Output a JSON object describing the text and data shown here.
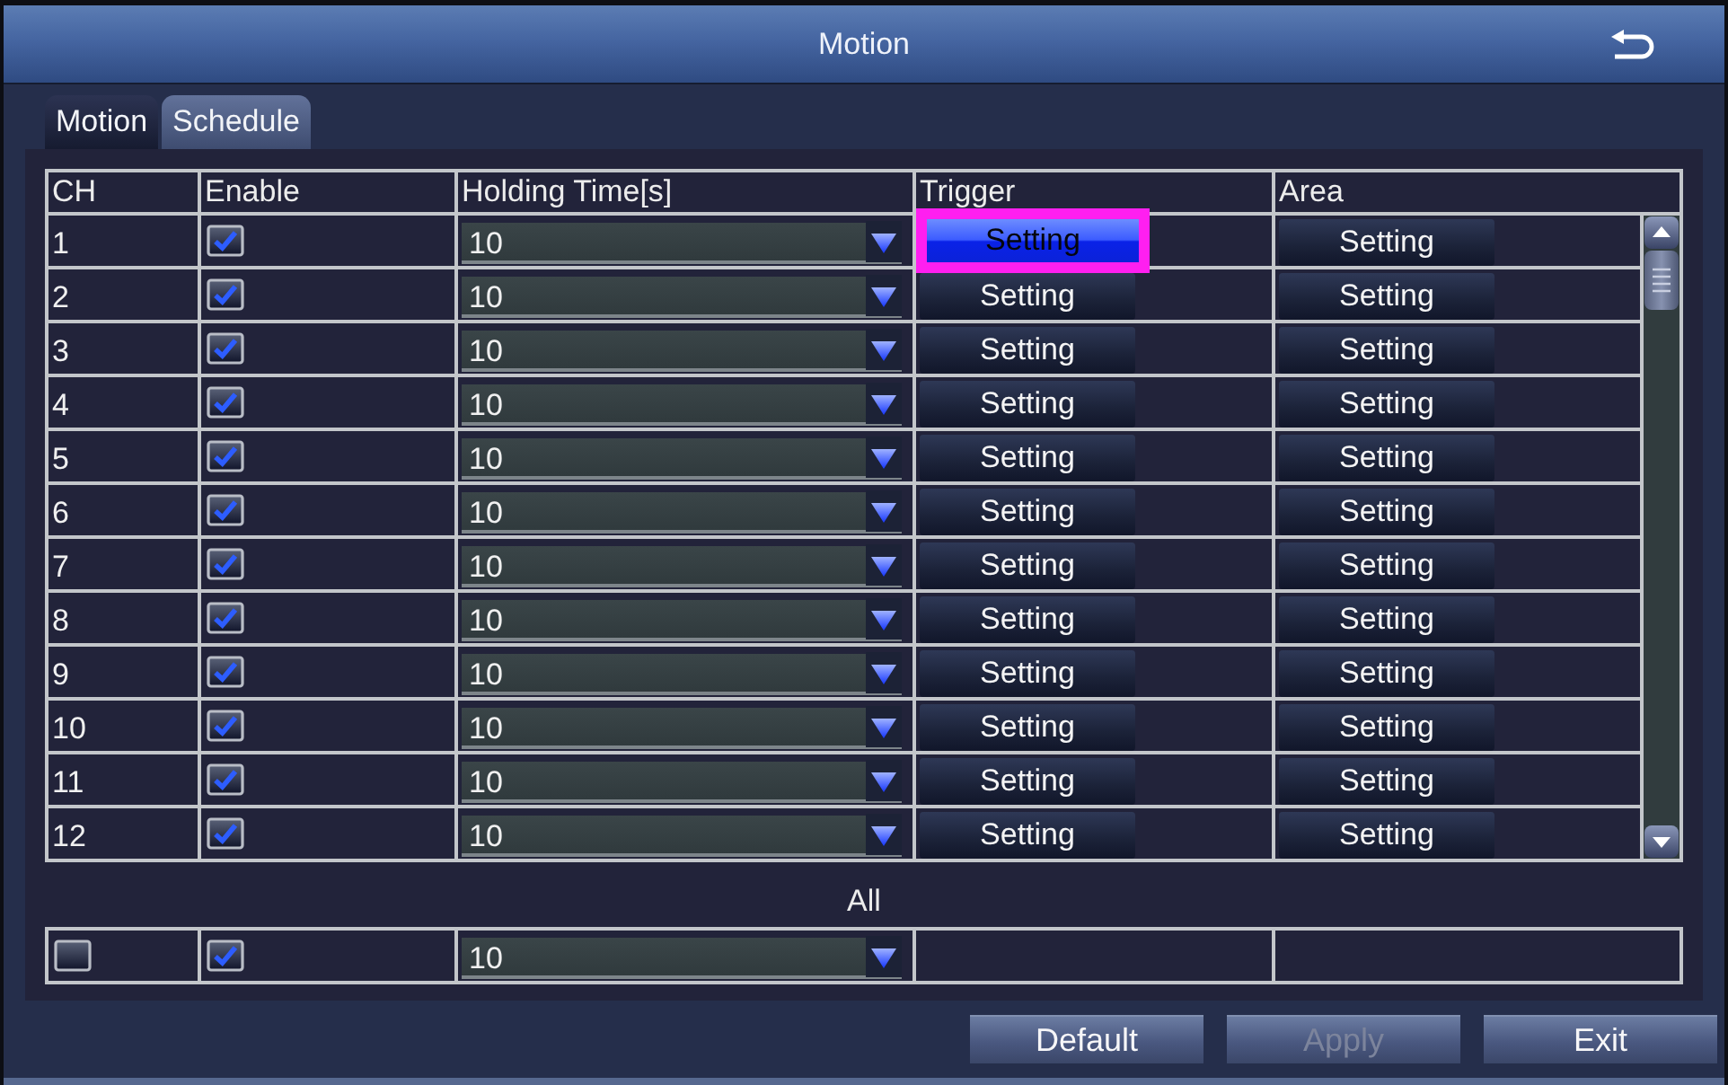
{
  "window": {
    "title": "Motion"
  },
  "tabs": [
    {
      "label": "Motion",
      "selected": true
    },
    {
      "label": "Schedule",
      "selected": false
    }
  ],
  "table": {
    "columns": [
      "CH",
      "Enable",
      "Holding Time[s]",
      "Trigger",
      "Area"
    ],
    "rows": [
      {
        "ch": "1",
        "enabled": true,
        "holding_time": "10",
        "trigger": {
          "label": "Setting",
          "selected": true
        },
        "area": {
          "label": "Setting",
          "selected": false
        }
      },
      {
        "ch": "2",
        "enabled": true,
        "holding_time": "10",
        "trigger": {
          "label": "Setting",
          "selected": false
        },
        "area": {
          "label": "Setting",
          "selected": false
        }
      },
      {
        "ch": "3",
        "enabled": true,
        "holding_time": "10",
        "trigger": {
          "label": "Setting",
          "selected": false
        },
        "area": {
          "label": "Setting",
          "selected": false
        }
      },
      {
        "ch": "4",
        "enabled": true,
        "holding_time": "10",
        "trigger": {
          "label": "Setting",
          "selected": false
        },
        "area": {
          "label": "Setting",
          "selected": false
        }
      },
      {
        "ch": "5",
        "enabled": true,
        "holding_time": "10",
        "trigger": {
          "label": "Setting",
          "selected": false
        },
        "area": {
          "label": "Setting",
          "selected": false
        }
      },
      {
        "ch": "6",
        "enabled": true,
        "holding_time": "10",
        "trigger": {
          "label": "Setting",
          "selected": false
        },
        "area": {
          "label": "Setting",
          "selected": false
        }
      },
      {
        "ch": "7",
        "enabled": true,
        "holding_time": "10",
        "trigger": {
          "label": "Setting",
          "selected": false
        },
        "area": {
          "label": "Setting",
          "selected": false
        }
      },
      {
        "ch": "8",
        "enabled": true,
        "holding_time": "10",
        "trigger": {
          "label": "Setting",
          "selected": false
        },
        "area": {
          "label": "Setting",
          "selected": false
        }
      },
      {
        "ch": "9",
        "enabled": true,
        "holding_time": "10",
        "trigger": {
          "label": "Setting",
          "selected": false
        },
        "area": {
          "label": "Setting",
          "selected": false
        }
      },
      {
        "ch": "10",
        "enabled": true,
        "holding_time": "10",
        "trigger": {
          "label": "Setting",
          "selected": false
        },
        "area": {
          "label": "Setting",
          "selected": false
        }
      },
      {
        "ch": "11",
        "enabled": true,
        "holding_time": "10",
        "trigger": {
          "label": "Setting",
          "selected": false
        },
        "area": {
          "label": "Setting",
          "selected": false
        }
      },
      {
        "ch": "12",
        "enabled": true,
        "holding_time": "10",
        "trigger": {
          "label": "Setting",
          "selected": false
        },
        "area": {
          "label": "Setting",
          "selected": false
        }
      }
    ]
  },
  "all": {
    "label": "All",
    "checked": false,
    "enabled": true,
    "holding_time": "10"
  },
  "buttons": [
    {
      "label": "Default",
      "disabled": false
    },
    {
      "label": "Apply",
      "disabled": true
    },
    {
      "label": "Exit",
      "disabled": false
    }
  ]
}
